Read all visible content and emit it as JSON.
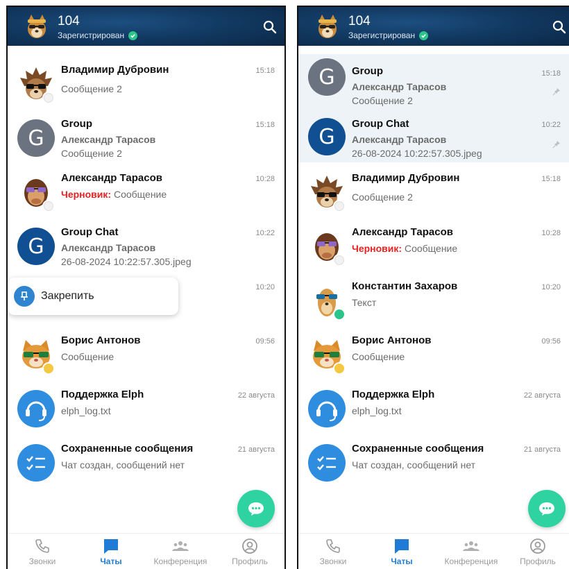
{
  "colors": {
    "accent": "#1f7bd6",
    "fab": "#2ed3a1",
    "online": "#2bc48a",
    "draft": "#e52222",
    "header": "#123a63"
  },
  "left": {
    "header": {
      "title": "104",
      "status": "Зарегистрирован"
    },
    "chats": [
      {
        "name": "Владимир Дубровин",
        "line1": "Сообщение 2",
        "time": "15:18",
        "avatar": "hedgehog-avatar"
      },
      {
        "name": "Group",
        "sender": "Александр Тарасов",
        "line2": "Сообщение 2",
        "time": "15:18",
        "avatar_letter": "G"
      },
      {
        "name": "Александр Тарасов",
        "draft_label": "Черновик:",
        "draft_text": " Сообщение",
        "time": "10:28",
        "avatar": "monkey-avatar"
      },
      {
        "name": "Group Chat",
        "sender": "Александр Тарасов",
        "line2": "26-08-2024 10:22:57.305.jpeg",
        "time": "10:22",
        "avatar_letter": "G"
      },
      {
        "time": "10:20"
      },
      {
        "name": "Борис Антонов",
        "line1": "Сообщение",
        "time": "09:56",
        "avatar": "cat-avatar"
      },
      {
        "name": "Поддержка Elph",
        "line1": "elph_log.txt",
        "time": "22 августа",
        "avatar": "support-avatar"
      },
      {
        "name": "Сохраненные сообщения",
        "line1": "Чат создан, сообщений нет",
        "time": "21 августа",
        "avatar": "saved-avatar"
      }
    ],
    "context_menu": {
      "pin_label": "Закрепить"
    }
  },
  "right": {
    "header": {
      "title": "104",
      "status": "Зарегистрирован"
    },
    "chats": [
      {
        "name": "Group",
        "sender": "Александр Тарасов",
        "line2": "Сообщение 2",
        "time": "15:18",
        "avatar_letter": "G"
      },
      {
        "name": "Group Chat",
        "sender": "Александр Тарасов",
        "line2": "26-08-2024 10:22:57.305.jpeg",
        "time": "10:22",
        "avatar_letter": "G"
      },
      {
        "name": "Владимир Дубровин",
        "line1": "Сообщение 2",
        "time": "15:18",
        "avatar": "hedgehog-avatar"
      },
      {
        "name": "Александр Тарасов",
        "draft_label": "Черновик:",
        "draft_text": " Сообщение",
        "time": "10:28",
        "avatar": "monkey-avatar"
      },
      {
        "name": "Константин Захаров",
        "line1": "Текст",
        "time": "10:20",
        "avatar": "meerkat-avatar"
      },
      {
        "name": "Борис Антонов",
        "line1": "Сообщение",
        "time": "09:56",
        "avatar": "cat-avatar"
      },
      {
        "name": "Поддержка Elph",
        "line1": "elph_log.txt",
        "time": "22 августа",
        "avatar": "support-avatar"
      },
      {
        "name": "Сохраненные сообщения",
        "line1": "Чат создан, сообщений нет",
        "time": "21 августа",
        "avatar": "saved-avatar"
      }
    ]
  },
  "nav": {
    "calls": "Звонки",
    "chats": "Чаты",
    "conferences": "Конференция",
    "profile": "Профиль"
  }
}
